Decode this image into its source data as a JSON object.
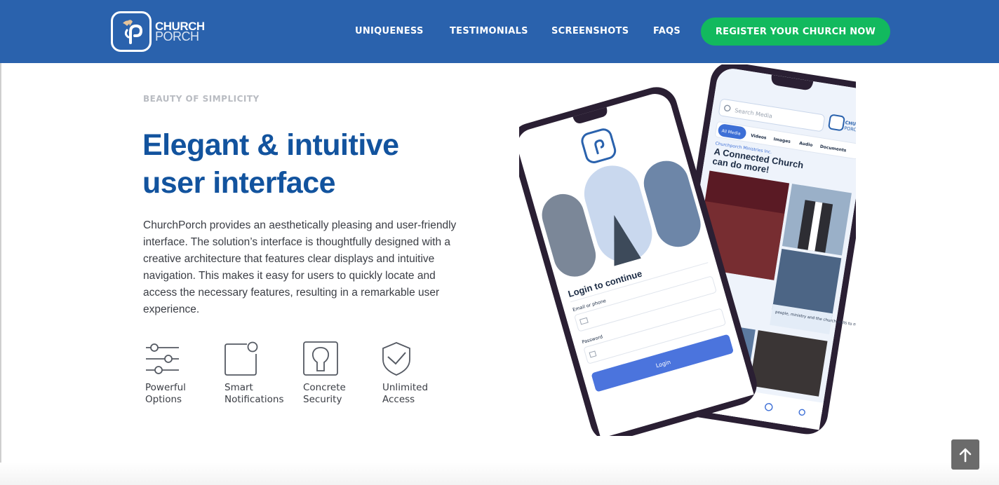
{
  "header": {
    "logo_line1": "CHURCH",
    "logo_line2": "PORCH",
    "nav": [
      {
        "label": "UNIQUENESS"
      },
      {
        "label": "TESTIMONIALS"
      },
      {
        "label": "SCREENSHOTS"
      },
      {
        "label": "FAQS"
      }
    ],
    "cta_label": "REGISTER YOUR CHURCH NOW"
  },
  "hero": {
    "eyebrow": "BEAUTY OF SIMPLICITY",
    "headline_line1": "Elegant & intuitive",
    "headline_line2": "user interface",
    "body": "ChurchPorch provides an aesthetically pleasing and user-friendly interface. The solution’s interface is thoughtfully designed with a creative architecture that features clear displays and intuitive navigation. This makes it easy for users to quickly locate and access the necessary features, resulting in a remarkable user experience."
  },
  "features": [
    {
      "line1": "Powerful",
      "line2": "Options",
      "icon": "sliders-icon"
    },
    {
      "line1": "Smart",
      "line2": "Notifications",
      "icon": "notification-icon"
    },
    {
      "line1": "Concrete",
      "line2": "Security",
      "icon": "keyhole-icon"
    },
    {
      "line1": "Unlimited",
      "line2": "Access",
      "icon": "shield-check-icon"
    }
  ],
  "phone_front": {
    "title": "Login to continue",
    "email_label": "Email or phone",
    "password_label": "Password",
    "button": "Login"
  },
  "phone_back": {
    "search_placeholder": "Search Media",
    "logo_line1": "CHURCH",
    "logo_line2": "PORCH",
    "tabs": [
      "All Media",
      "Videos",
      "Images",
      "Audio",
      "Documents"
    ],
    "org": "Churchporch Ministries Inc.",
    "headline": "A Connected Church can do more!",
    "caption": "people, ministry and the church walls to members."
  },
  "colors": {
    "brand": "#2a62ad",
    "headline": "#12539e",
    "cta": "#12b95e"
  }
}
